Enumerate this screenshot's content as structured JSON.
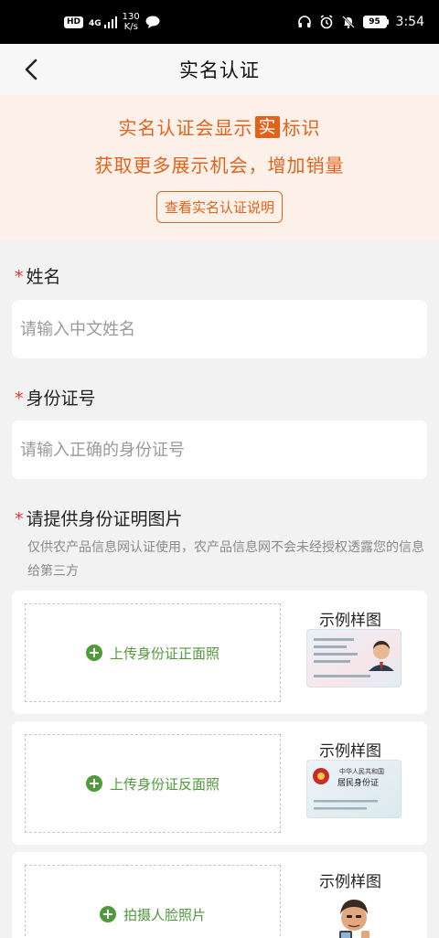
{
  "status_bar": {
    "hd": "HD",
    "network": "4G",
    "speed_value": "130",
    "speed_unit": "K/s",
    "battery": "95",
    "time": "3:54"
  },
  "header": {
    "title": "实名认证"
  },
  "banner": {
    "line1_prefix": "实名认证会显示",
    "line1_badge": "实",
    "line1_suffix": "标识",
    "line2": "获取更多展示机会，增加销量",
    "button_label": "查看实名认证说明"
  },
  "form": {
    "required_mark": "*",
    "name_label": "姓名",
    "name_placeholder": "请输入中文姓名",
    "id_label": "身份证号",
    "id_placeholder": "请输入正确的身份证号",
    "photo_label": "请提供身份证明图片",
    "photo_hint": "仅供农产品信息网认证使用，农产品信息网不会未经授权透露您的信息给第三方"
  },
  "uploads": [
    {
      "label": "上传身份证正面照",
      "sample_label": "示例样图"
    },
    {
      "label": "上传身份证反面照",
      "sample_label": "示例样图"
    },
    {
      "label": "拍摄人脸照片",
      "sample_label": "示例样图"
    }
  ],
  "sample_cards": {
    "back_line1": "中华人民共和国",
    "back_line2": "居民身份证"
  },
  "colors": {
    "accent": "#e2621b",
    "banner_bg": "#fdf1ea",
    "upload_green": "#4f9a3a",
    "required_red": "#e03a2f"
  }
}
